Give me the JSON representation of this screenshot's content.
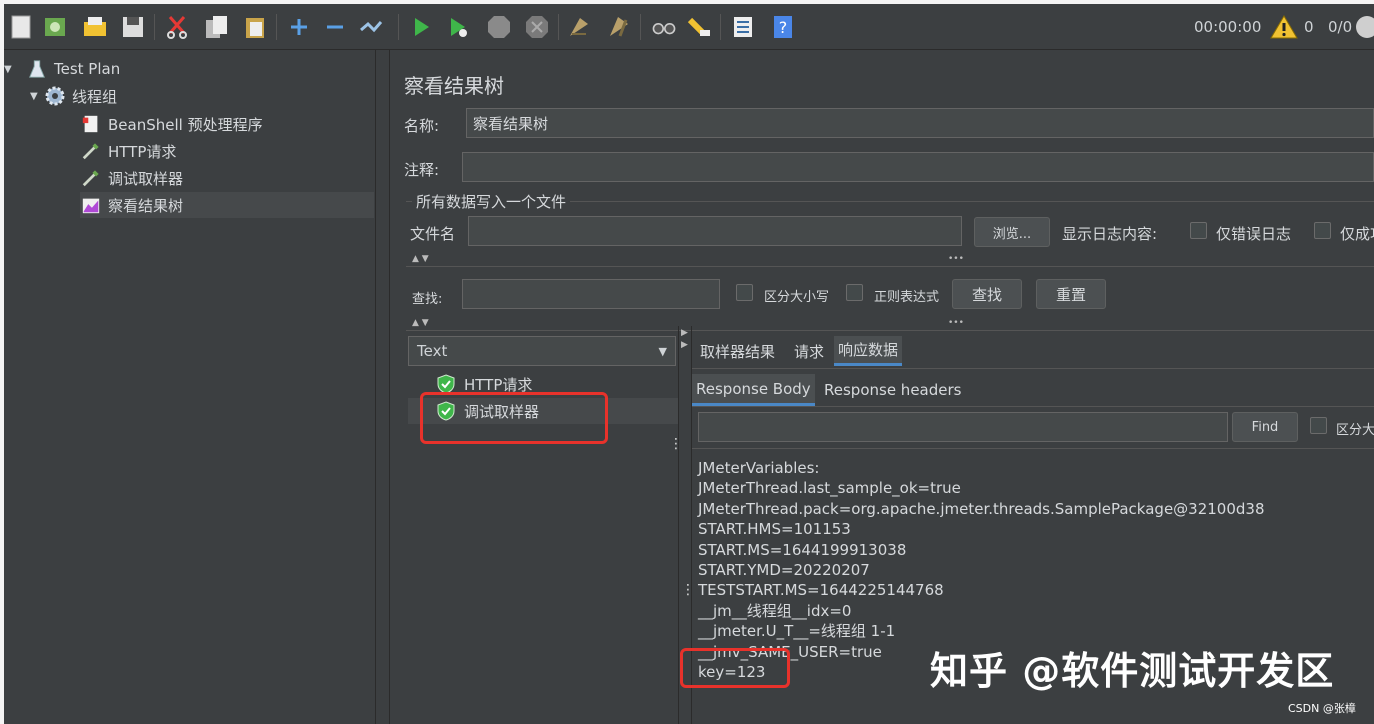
{
  "toolbar": {
    "icons": [
      "new-icon",
      "templates-icon",
      "open-icon",
      "save-icon",
      "cut-icon",
      "copy-icon",
      "paste-icon",
      "add-icon",
      "remove-icon",
      "toggle-icon",
      "start-icon",
      "start-no-pause-icon",
      "stop-icon",
      "shutdown-icon",
      "clear-icon",
      "clear-all-icon",
      "search-icon",
      "reset-search-icon",
      "function-helper-icon",
      "help-icon"
    ],
    "timer": "00:00:00",
    "warning_count": "0",
    "thread_count": "0/0"
  },
  "tree": {
    "items": [
      {
        "label": "Test Plan"
      },
      {
        "label": "线程组"
      },
      {
        "label": "BeanShell 预处理程序"
      },
      {
        "label": "HTTP请求"
      },
      {
        "label": "调试取样器"
      },
      {
        "label": "察看结果树"
      }
    ]
  },
  "panel": {
    "title": "察看结果树",
    "name_label": "名称:",
    "name_value": "察看结果树",
    "comment_label": "注释:",
    "comment_value": "",
    "file_section_title": "所有数据写入一个文件",
    "filename_label": "文件名",
    "filename_value": "",
    "browse_button": "浏览...",
    "log_content_label": "显示日志内容:",
    "errors_only_label": "仅错误日志",
    "success_only_label": "仅成功",
    "search_label": "查找:",
    "search_value": "",
    "case_sensitive_label": "区分大小写",
    "regex_label": "正则表达式",
    "find_button": "查找",
    "reset_button": "重置"
  },
  "results": {
    "renderer_selected": "Text",
    "samples": [
      {
        "label": "HTTP请求"
      },
      {
        "label": "调试取样器"
      }
    ],
    "tabs": [
      "取样器结果",
      "请求",
      "响应数据"
    ],
    "subtabs": [
      "Response Body",
      "Response headers"
    ],
    "body_search_value": "",
    "body_find_button": "Find",
    "body_case_label": "区分大",
    "response_lines": [
      "JMeterVariables:",
      "JMeterThread.last_sample_ok=true",
      "JMeterThread.pack=org.apache.jmeter.threads.SamplePackage@32100d38",
      "START.HMS=101153",
      "START.MS=1644199913038",
      "START.YMD=20220207",
      "TESTSTART.MS=1644225144768",
      "__jm__线程组__idx=0",
      "__jmeter.U_T__=线程组 1-1",
      "__jmv_SAME_USER=true",
      "key=123"
    ]
  },
  "overlay": {
    "watermark": "知乎 @软件测试开发区",
    "csdn": "CSDN @张樟"
  },
  "colors": {
    "bg": "#3c3f41",
    "highlight": "#e8322b",
    "tab_accent": "#4a88c7"
  }
}
